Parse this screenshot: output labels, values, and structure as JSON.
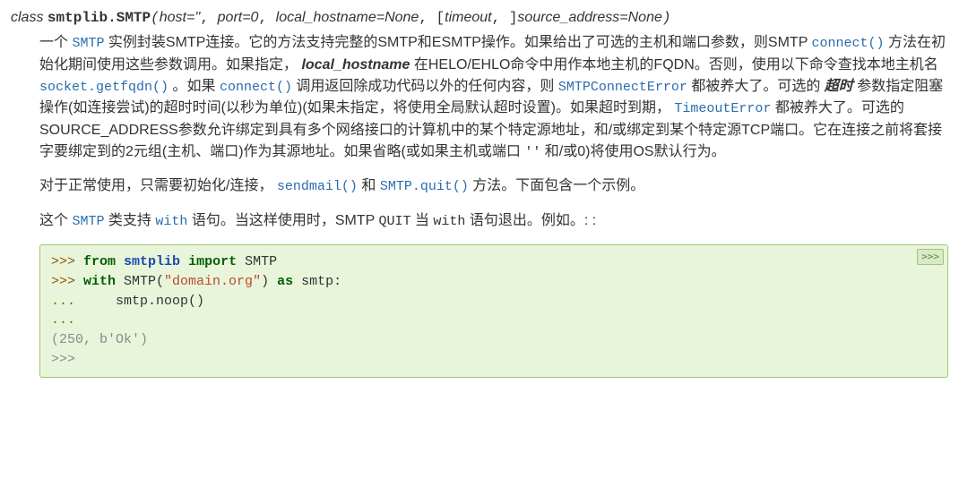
{
  "sig": {
    "prefix": "class ",
    "module": "smtplib.",
    "name": "SMTP",
    "open": "(",
    "p1": "host=''",
    "c1": ", ",
    "p2": "port=0",
    "c2": ", ",
    "p3": "local_hostname=None",
    "c3": ", ",
    "lb": "[",
    "p4": "timeout",
    "c4": ", ",
    "rb": "]",
    "p5": "source_address=None",
    "close": ")"
  },
  "refs": {
    "smtp": "SMTP",
    "connect": "connect()",
    "getfqdn": "socket.getfqdn()",
    "connect2": "connect()",
    "smtpconnerr": "SMTPConnectError",
    "timeouterr": "TimeoutError",
    "sendmail": "sendmail()",
    "quit": "SMTP.quit()",
    "smtp2": "SMTP",
    "withref": "with"
  },
  "lits": {
    "quit": "QUIT",
    "with2": "with",
    "empty": "''"
  },
  "em": {
    "local_hostname": "local_hostname",
    "timeout": "超时"
  },
  "p1": {
    "t1": "一个 ",
    "t2": " 实例封装SMTP连接。它的方法支持完整的SMTP和ESMTP操作。如果给出了可选的主机和端口参数，则SMTP ",
    "t3": " 方法在初始化期间使用这些参数调用。如果指定， ",
    "t4": " 在HELO/EHLO命令中用作本地主机的FQDN。否则，使用以下命令查找本地主机名 ",
    "t5": " 。如果 ",
    "t6": " 调用返回除成功代码以外的任何内容，则 ",
    "t7": " 都被养大了。可选的 ",
    "t8": " 参数指定阻塞操作(如连接尝试)的超时时间(以秒为单位)(如果未指定，将使用全局默认超时设置)。如果超时到期， ",
    "t9": " 都被养大了。可选的SOURCE_ADDRESS参数允许绑定到具有多个网络接口的计算机中的某个特定源地址，和/或绑定到某个特定源TCP端口。它在连接之前将套接字要绑定到的2元组(主机、端口)作为其源地址。如果省略(或如果主机或端口 ",
    "t10": " 和/或0)将使用OS默认行为。"
  },
  "p2": {
    "t1": "对于正常使用，只需要初始化/连接， ",
    "t2": " 和 ",
    "t3": " 方法。下面包含一个示例。"
  },
  "p3": {
    "t1": "这个 ",
    "t2": " 类支持 ",
    "t3": " 语句。当这样使用时，SMTP ",
    "t4": " 当 ",
    "t5": " 语句退出。例如。: :"
  },
  "code": {
    "copy": ">>>",
    "l1a": ">>> ",
    "l1b": "from",
    "l1c": " ",
    "l1d": "smtplib",
    "l1e": " ",
    "l1f": "import",
    "l1g": " SMTP",
    "l2a": ">>> ",
    "l2b": "with",
    "l2c": " SMTP(",
    "l2d": "\"domain.org\"",
    "l2e": ") ",
    "l2f": "as",
    "l2g": " smtp:",
    "l3a": "... ",
    "l3b": "    smtp.noop()",
    "l4a": "...",
    "l5": "(250, b'Ok')",
    "l6": ">>>"
  }
}
